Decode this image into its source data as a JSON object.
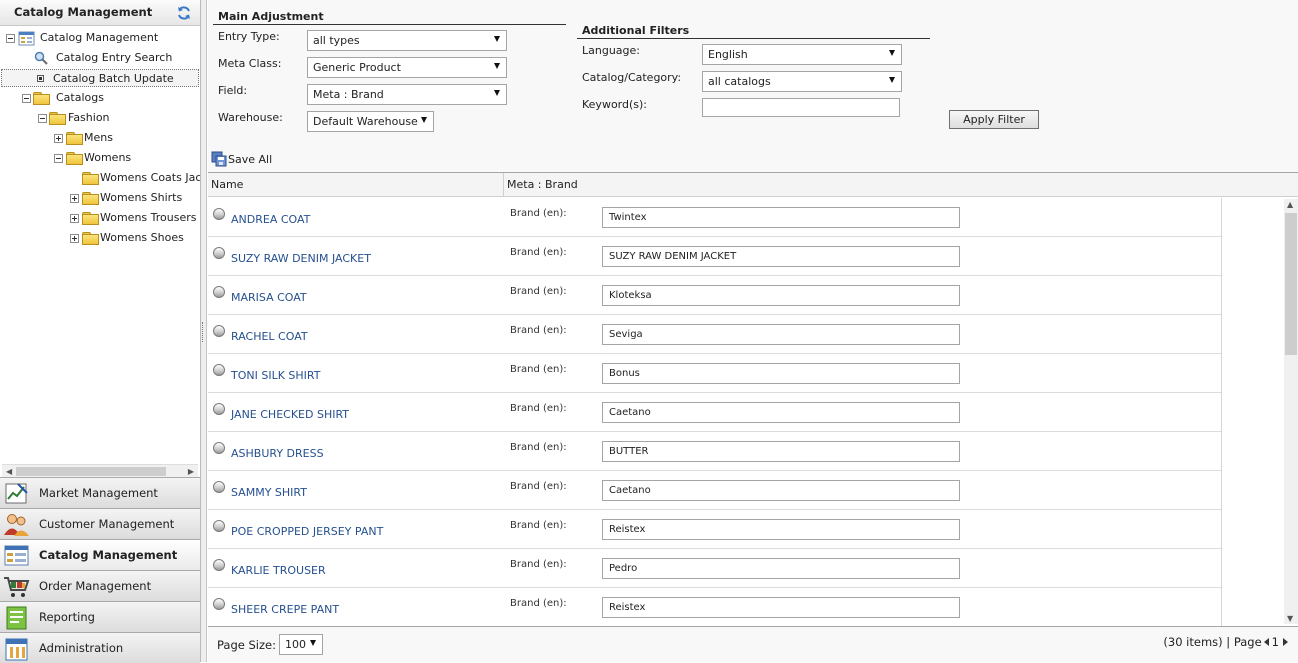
{
  "app": {
    "panel_title": "Catalog Management"
  },
  "tree": {
    "root": "Catalog Management",
    "entry_search": "Catalog Entry Search",
    "batch_update": "Catalog Batch Update",
    "catalogs": "Catalogs",
    "fashion": "Fashion",
    "mens": "Mens",
    "womens": "Womens",
    "womens_coats": "Womens Coats Jacl",
    "womens_shirts": "Womens Shirts",
    "womens_trousers": "Womens Trousers",
    "womens_shoes": "Womens Shoes"
  },
  "nav": [
    {
      "label": "Market Management",
      "icon": "market-chart-icon"
    },
    {
      "label": "Customer Management",
      "icon": "customers-icon"
    },
    {
      "label": "Catalog Management",
      "icon": "catalog-icon"
    },
    {
      "label": "Order Management",
      "icon": "shopping-cart-icon"
    },
    {
      "label": "Reporting",
      "icon": "report-icon"
    },
    {
      "label": "Administration",
      "icon": "admin-icon"
    }
  ],
  "main_adjustment": {
    "title": "Main Adjustment",
    "entry_type_label": "Entry Type:",
    "entry_type_value": "all types",
    "meta_class_label": "Meta Class:",
    "meta_class_value": "Generic Product",
    "field_label": "Field:",
    "field_value": "Meta : Brand",
    "warehouse_label": "Warehouse:",
    "warehouse_value": "Default Warehouse"
  },
  "additional_filters": {
    "title": "Additional Filters",
    "language_label": "Language:",
    "language_value": "English",
    "catalog_label": "Catalog/Category:",
    "catalog_value": "all catalogs",
    "keyword_label": "Keyword(s):",
    "keyword_value": "",
    "apply_label": "Apply Filter"
  },
  "toolbar": {
    "save_all": "Save All"
  },
  "grid": {
    "col_name": "Name",
    "col_field": "Meta : Brand",
    "field_label": "Brand (en):",
    "rows": [
      {
        "name": "ANDREA COAT",
        "value": "Twintex"
      },
      {
        "name": "SUZY RAW DENIM JACKET",
        "value": "SUZY RAW DENIM JACKET"
      },
      {
        "name": "MARISA COAT",
        "value": "Kloteksa"
      },
      {
        "name": "RACHEL COAT",
        "value": "Seviga"
      },
      {
        "name": "TONI SILK SHIRT",
        "value": "Bonus"
      },
      {
        "name": "JANE CHECKED SHIRT",
        "value": "Caetano"
      },
      {
        "name": "ASHBURY DRESS",
        "value": "BUTTER"
      },
      {
        "name": "SAMMY SHIRT",
        "value": "Caetano"
      },
      {
        "name": "POE CROPPED JERSEY PANT",
        "value": "Reistex"
      },
      {
        "name": "KARLIE TROUSER",
        "value": "Pedro"
      },
      {
        "name": "SHEER CREPE PANT",
        "value": "Reistex"
      }
    ]
  },
  "pager": {
    "page_size_label": "Page Size:",
    "page_size_value": "100",
    "items_text": "(30 items) | Page",
    "page_number": "1"
  }
}
